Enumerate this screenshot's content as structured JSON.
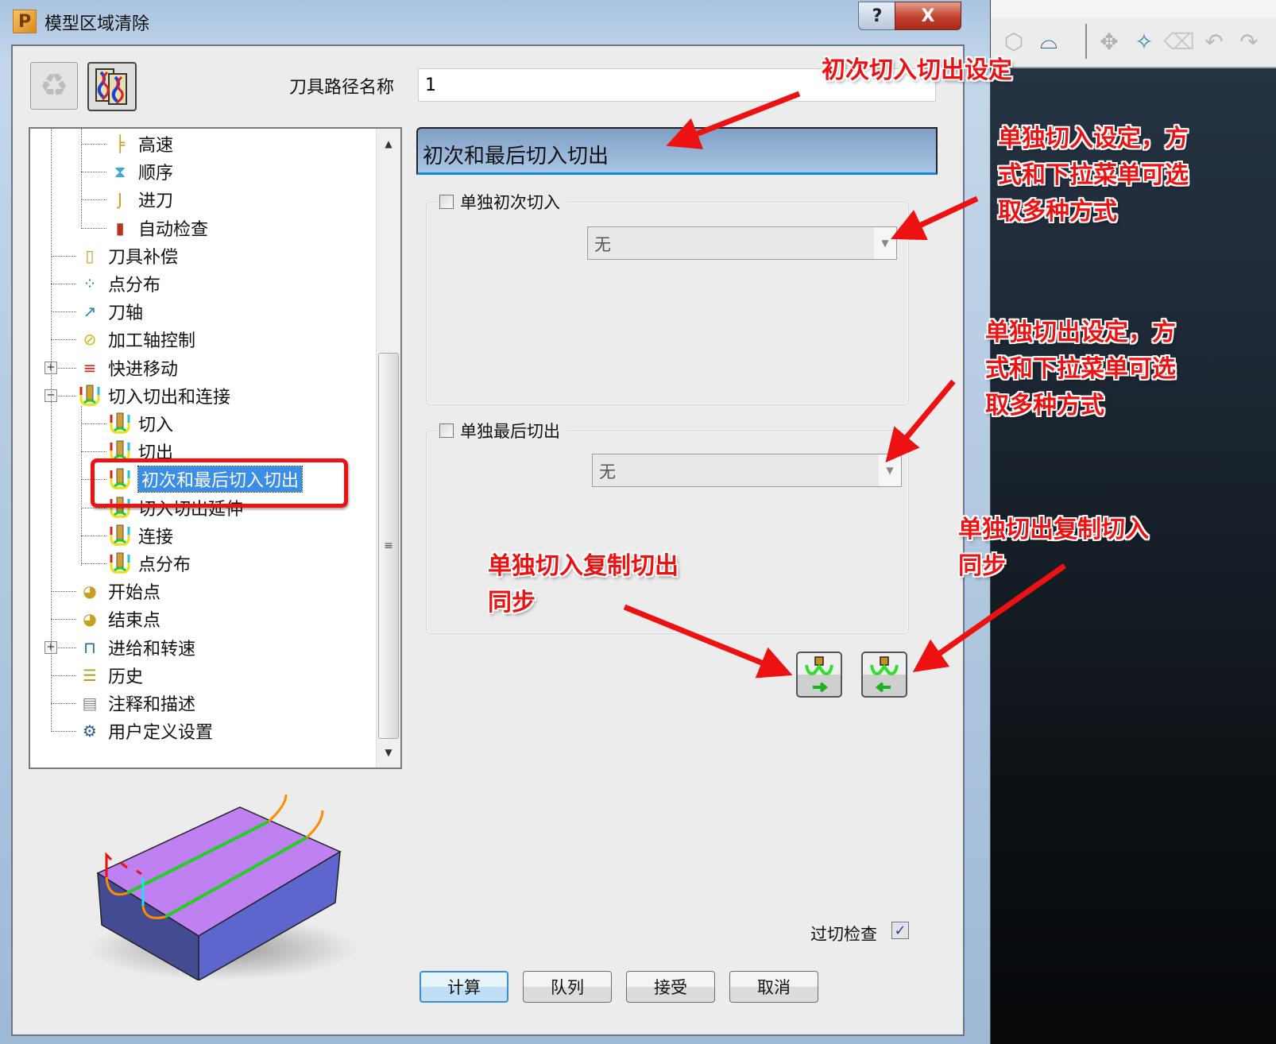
{
  "dialog": {
    "title": "模型区域清除",
    "help_glyph": "?",
    "close_glyph": "X",
    "toolpath_name_label": "刀具路径名称",
    "toolpath_name_value": "1"
  },
  "tree": {
    "items": [
      {
        "label": "高速",
        "icon": "high-speed-icon",
        "level": 2
      },
      {
        "label": "顺序",
        "icon": "ordering-icon",
        "level": 2
      },
      {
        "label": "进刀",
        "icon": "approach-icon",
        "level": 2
      },
      {
        "label": "自动检查",
        "icon": "auto-verify-icon",
        "level": 2
      },
      {
        "label": "刀具补偿",
        "icon": "tool-compensation-icon",
        "level": 1
      },
      {
        "label": "点分布",
        "icon": "point-distribution-icon",
        "level": 1
      },
      {
        "label": "刀轴",
        "icon": "tool-axis-icon",
        "level": 1
      },
      {
        "label": "加工轴控制",
        "icon": "axis-control-icon",
        "level": 1
      },
      {
        "label": "快进移动",
        "icon": "rapid-move-icon",
        "level": 1,
        "expander": "+"
      },
      {
        "label": "切入切出和连接",
        "icon": "leads-links-icon",
        "level": 1,
        "expander": "-"
      },
      {
        "label": "切入",
        "icon": "lead-in-icon",
        "level": 2
      },
      {
        "label": "切出",
        "icon": "lead-out-icon",
        "level": 2
      },
      {
        "label": "初次和最后切入切出",
        "icon": "first-last-leads-icon",
        "level": 2,
        "selected": true
      },
      {
        "label": "切入切出延伸",
        "icon": "lead-extension-icon",
        "level": 2
      },
      {
        "label": "连接",
        "icon": "links-icon",
        "level": 2
      },
      {
        "label": "点分布",
        "icon": "link-point-distribution-icon",
        "level": 2
      },
      {
        "label": "开始点",
        "icon": "start-point-icon",
        "level": 1
      },
      {
        "label": "结束点",
        "icon": "end-point-icon",
        "level": 1
      },
      {
        "label": "进给和转速",
        "icon": "feeds-speeds-icon",
        "level": 1,
        "expander": "+"
      },
      {
        "label": "历史",
        "icon": "history-icon",
        "level": 1
      },
      {
        "label": "注释和描述",
        "icon": "notes-icon",
        "level": 1
      },
      {
        "label": "用户定义设置",
        "icon": "user-settings-icon",
        "level": 1
      }
    ]
  },
  "panel": {
    "section_title": "初次和最后切入切出",
    "first_lead_in": {
      "checkbox_label": "单独初次切入",
      "checked": false,
      "combo_value": "无"
    },
    "last_lead_out": {
      "checkbox_label": "单独最后切出",
      "checked": false,
      "combo_value": "无"
    },
    "gouge_check_label": "过切检查",
    "gouge_check_checked": true,
    "gouge_check_glyph": "✓"
  },
  "buttons": {
    "calculate": "计算",
    "queue": "队列",
    "accept": "接受",
    "cancel": "取消"
  },
  "annotations": {
    "first_lead_setting": "初次切入切出设定",
    "lead_in_setting": "单独切入设定，方\n式和下拉菜单可选\n取多种方式",
    "lead_out_setting": "单独切出设定，方\n式和下拉菜单可选\n取多种方式",
    "copy_in_to_out": "单独切入复制切出\n同步",
    "copy_out_to_in": "单独切出复制切入\n同步"
  },
  "colors": {
    "annotation": "#ee1111",
    "selection": "#3a8ee6",
    "header_gradient_top": "#7f9fc4",
    "viewport_bg": "#1b2530"
  }
}
